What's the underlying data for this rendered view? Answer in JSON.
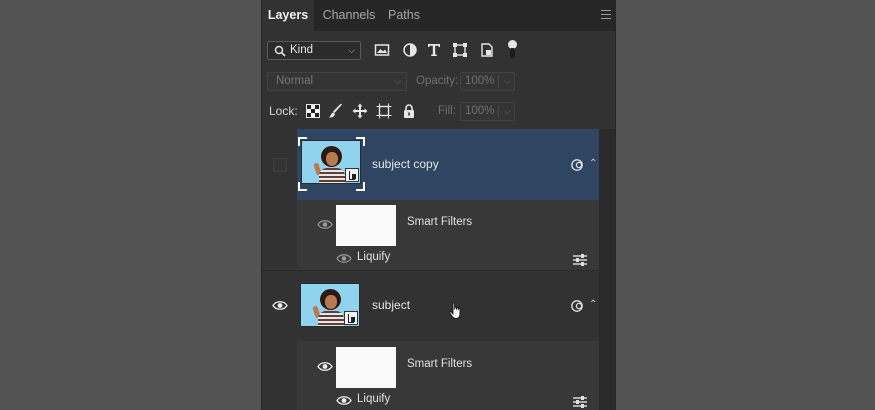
{
  "tabs": [
    {
      "label": "Layers",
      "active": true
    },
    {
      "label": "Channels",
      "active": false
    },
    {
      "label": "Paths",
      "active": false
    }
  ],
  "panel_menu_icon": "hamburger-icon",
  "filter": {
    "kind_label": "Kind",
    "kind_icon": "search-icon",
    "filter_icons": [
      "pixel-layer-filter-icon",
      "adjustment-layer-filter-icon",
      "type-layer-filter-icon",
      "shape-layer-filter-icon",
      "smart-object-filter-icon",
      "filter-toggle-icon"
    ]
  },
  "blend": {
    "mode": "Normal",
    "opacity_label": "Opacity:",
    "opacity_value": "100%",
    "fill_label": "Fill:",
    "fill_value": "100%"
  },
  "lock": {
    "label": "Lock:",
    "icons": [
      "lock-transparent-pixels-icon",
      "lock-image-pixels-icon",
      "lock-position-icon",
      "lock-artboard-icon",
      "lock-all-icon"
    ]
  },
  "layers": [
    {
      "name": "subject copy",
      "selected": true,
      "visible": false,
      "smart_object": true,
      "smart_filters": {
        "label": "Smart Filters",
        "visible": true
      },
      "filter": {
        "name": "Liquify",
        "visible": true
      }
    },
    {
      "name": "subject",
      "selected": false,
      "visible": true,
      "smart_object": true,
      "smart_filters": {
        "label": "Smart Filters",
        "visible": true
      },
      "filter": {
        "name": "Liquify",
        "visible": true
      }
    }
  ],
  "colors": {
    "panel_bg": "#323232",
    "selection": "#2f4562",
    "page_bg": "#535353",
    "thumb_sky": "#8fd3ee"
  }
}
